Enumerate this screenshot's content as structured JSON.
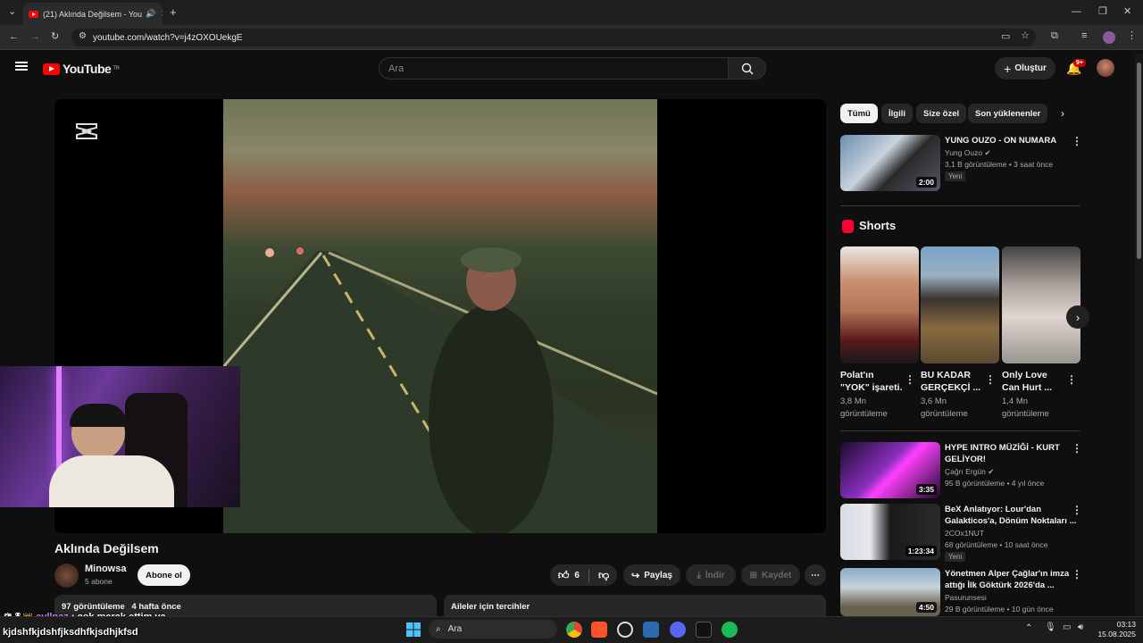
{
  "browser": {
    "tab_title": "(21) Aklında Değilsem - You",
    "url": "youtube.com/watch?v=j4zOXOUekgE"
  },
  "header": {
    "logo_text": "YouTube",
    "region": "TR",
    "search_placeholder": "Ara",
    "create_label": "Oluştur",
    "notif_count": "9+"
  },
  "chips": [
    "Tümü",
    "İlgili",
    "Size özel",
    "Son yüklenenler"
  ],
  "video": {
    "title": "Aklında Değilsem",
    "channel": "Minowsa",
    "subscribers": "5 abone",
    "subscribe_label": "Abone ol",
    "likes": "6",
    "share_label": "Paylaş",
    "download_label": "İndir",
    "save_label": "Kaydet",
    "views": "97 görüntüleme",
    "age": "4 hafta önce",
    "panel_right_title": "Aileler için tercihler"
  },
  "recommendations_top": {
    "title": "YUNG OUZO - ON NUMARA",
    "channel": "Yung Ouzo",
    "meta": "3,1 B görüntüleme • 3 saat önce",
    "badge": "Yeni",
    "duration": "2:00"
  },
  "shorts": {
    "heading": "Shorts",
    "items": [
      {
        "title1": "Polat'ın",
        "title2": "\"YOK\" işareti.",
        "views1": "3,8 Mn",
        "views2": "görüntüleme"
      },
      {
        "title1": "BU KADAR",
        "title2": "GERÇEKÇİ ...",
        "views1": "3,6 Mn",
        "views2": "görüntüleme"
      },
      {
        "title1": "Only Love",
        "title2": "Can Hurt ...",
        "views1": "1,4 Mn",
        "views2": "görüntüleme"
      }
    ]
  },
  "recommendations": [
    {
      "title1": "HYPE INTRO MÜZİĞİ - KURT",
      "title2": "GELİYOR!",
      "channel": "Çağrı Ergün",
      "meta": "95 B görüntüleme • 4 yıl önce",
      "duration": "3:35",
      "badge": ""
    },
    {
      "title1": "BeX Anlatıyor: Lour'dan",
      "title2": "Galakticos'a, Dönüm Noktaları ...",
      "channel": "2COx1NUT",
      "meta": "68 görüntüleme • 10 saat önce",
      "duration": "1:23:34",
      "badge": "Yeni"
    },
    {
      "title1": "Yönetmen Alper Çağlar'ın imza",
      "title2": "attığı İlk Göktürk 2026'da ...",
      "channel": "Pasurunsesi",
      "meta": "29 B görüntüleme • 10 gün önce",
      "duration": "4:50",
      "badge": ""
    }
  ],
  "chat_overlay": {
    "user": "eyllnaz",
    "line1": ": çok merak ettim ya",
    "line2": "kjdshfkjdshfjksdhfkjsdhjkfsd"
  },
  "taskbar": {
    "search_label": "Ara",
    "time": "03:13",
    "date": "15.08.2025"
  },
  "colors": {
    "accent": "#ff0000",
    "bg": "#0f0f0f",
    "surface": "#272727"
  }
}
